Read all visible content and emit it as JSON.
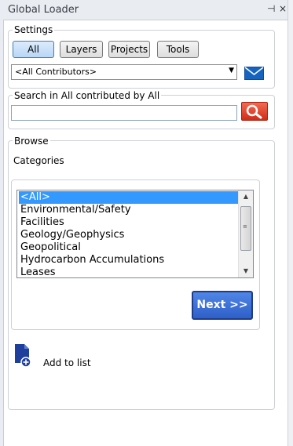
{
  "window": {
    "title": "Global Loader",
    "pin_glyph": "⊣",
    "close_glyph": "×"
  },
  "settings": {
    "legend": "Settings",
    "buttons": [
      "All",
      "Layers",
      "Projects",
      "Tools"
    ],
    "active_button": "All",
    "contributor_dropdown": {
      "selected": "<All Contributors>"
    },
    "mail_icon": "mail-icon"
  },
  "search": {
    "legend": "Search in All contributed by All",
    "value": "",
    "search_icon": "search-icon"
  },
  "browse": {
    "legend": "Browse",
    "categories_label": "Categories",
    "items": [
      "<All>",
      "Environmental/Safety",
      "Facilities",
      "Geology/Geophysics",
      "Geopolitical",
      "Hydrocarbon Accumulations",
      "Leases"
    ],
    "selected_index": 0,
    "next_label": "Next >>"
  },
  "add_to_list": {
    "label": "Add to list",
    "icon": "document-add-icon"
  },
  "colors": {
    "accent": "#3399ff",
    "next_button": "#3a6fd8",
    "search_button": "#e0402a",
    "mail": "#1565c0"
  }
}
